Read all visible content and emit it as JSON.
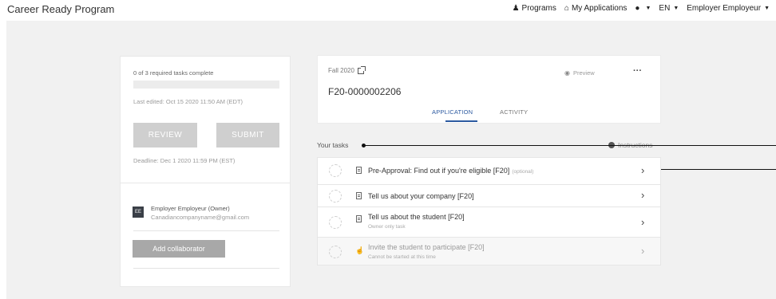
{
  "header": {
    "brand": "Career Ready Program",
    "nav": {
      "programs": "Programs",
      "my_applications": "My Applications",
      "language": "EN",
      "user": "Employer Employeur"
    }
  },
  "summary": {
    "progress_text": "0 of 3 required tasks complete",
    "progress_fraction": 0,
    "last_edited": "Last edited: Oct 15 2020 11:50 AM (EDT)",
    "review_label": "REVIEW",
    "submit_label": "SUBMIT",
    "deadline": "Deadline: Dec 1 2020 11:59 PM (EST)",
    "owner": {
      "initials": "EE",
      "name": "Employer Employeur (Owner)",
      "email": "Canadiancompanyname@gmail.com"
    },
    "add_collaborator_label": "Add collaborator"
  },
  "application": {
    "term": "Fall 2020",
    "id": "F20-0000002206",
    "preview_label": "Preview",
    "tabs": [
      "APPLICATION",
      "ACTIVITY"
    ],
    "active_tab": "APPLICATION"
  },
  "tasks_section": {
    "heading": "Your tasks",
    "instructions_label": "Instructions",
    "tasks": [
      {
        "title": "Pre-Approval: Find out if you're eligible [F20]",
        "tag": "(optional)",
        "subtitle": ""
      },
      {
        "title": "Tell us about your company [F20]",
        "tag": "",
        "subtitle": ""
      },
      {
        "title": "Tell us about the student [F20]",
        "tag": "",
        "subtitle": "Owner only task"
      },
      {
        "title": "Invite the student to participate [F20]",
        "tag": "",
        "subtitle": "Cannot be started at this time"
      }
    ]
  },
  "icons": {
    "programs": "people-icon",
    "my_applications": "home-icon",
    "help": "info-icon",
    "external": "external-link-icon",
    "preview": "eye-icon",
    "more": "more-icon",
    "task_doc": "document-icon",
    "task_locked": "thumbs-up-icon",
    "chevron": "chevron-right-icon"
  },
  "colors": {
    "accent": "#2c5aa0",
    "button_disabled": "#cfcfcf",
    "collab_button": "#a8a8a8",
    "background": "#f1f1f1"
  }
}
